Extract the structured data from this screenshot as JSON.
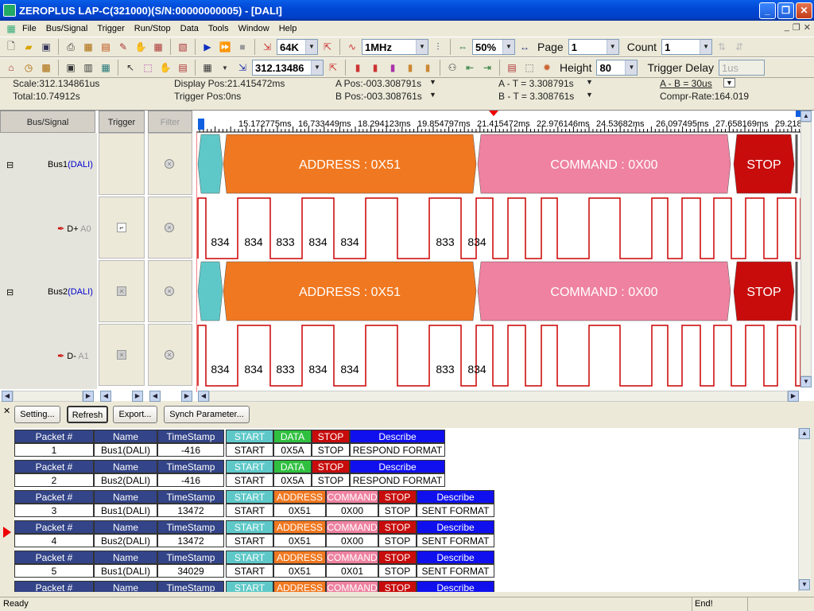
{
  "window": {
    "title": "ZEROPLUS LAP-C(321000)(S/N:00000000005) - [DALI]"
  },
  "menu": [
    "File",
    "Bus/Signal",
    "Trigger",
    "Run/Stop",
    "Data",
    "Tools",
    "Window",
    "Help"
  ],
  "toolbar1": {
    "memory": "64K",
    "rate": "1MHz",
    "zoom": "50%",
    "page_label": "Page",
    "page": "1",
    "count_label": "Count",
    "count": "1"
  },
  "toolbar2": {
    "position": "312.13486",
    "height_label": "Height",
    "height": "80",
    "trigger_delay_label": "Trigger Delay",
    "trigger_delay": "1us"
  },
  "info": {
    "scale": "Scale:312.134861us",
    "total": "Total:10.74912s",
    "display_pos": "Display Pos:21.415472ms",
    "trigger_pos": "Trigger Pos:0ns",
    "a_pos": "A Pos:-003.308791s",
    "b_pos": "B Pos:-003.308761s",
    "a_t": "A - T = 3.308791s",
    "b_t": "B - T = 3.308761s",
    "a_b": "A - B = 30us",
    "compr": "Compr-Rate:164.019"
  },
  "columns": {
    "bus_signal": "Bus/Signal",
    "trigger": "Trigger",
    "filter": "Filter"
  },
  "signals": [
    {
      "name": "Bus1",
      "tag": "(DALI)"
    },
    {
      "name": "D+",
      "tag": "A0"
    },
    {
      "name": "Bus2",
      "tag": "(DALI)"
    },
    {
      "name": "D-",
      "tag": "A1"
    }
  ],
  "time_ticks": [
    "15.172775ms",
    "16.733449ms",
    "18.294123ms",
    "19.854797ms",
    "21.415472ms",
    "22.976146ms",
    "24.53682ms",
    "26.097495ms",
    "27.658169ms",
    "29.218"
  ],
  "bus_segments": [
    {
      "label": "",
      "color": "#5ec8c8"
    },
    {
      "label": "ADDRESS : 0X51",
      "color": "#f07820"
    },
    {
      "label": "COMMAND : 0X00",
      "color": "#ee82a0"
    },
    {
      "label": "STOP",
      "color": "#c80c0c"
    }
  ],
  "pulse_labels": [
    "834",
    "834",
    "833",
    "834",
    "834",
    "833",
    "834"
  ],
  "buttons": {
    "setting": "Setting...",
    "refresh": "Refresh",
    "export": "Export...",
    "synch": "Synch Parameter..."
  },
  "packets": [
    {
      "header": [
        "Packet #",
        "Name",
        "TimeStamp",
        "START",
        "DATA",
        "STOP",
        "Describe"
      ],
      "values": [
        "1",
        "Bus1(DALI)",
        "-416",
        "START",
        "0X5A",
        "STOP",
        "RESPOND FORMAT"
      ]
    },
    {
      "header": [
        "Packet #",
        "Name",
        "TimeStamp",
        "START",
        "DATA",
        "STOP",
        "Describe"
      ],
      "values": [
        "2",
        "Bus2(DALI)",
        "-416",
        "START",
        "0X5A",
        "STOP",
        "RESPOND FORMAT"
      ]
    },
    {
      "header": [
        "Packet #",
        "Name",
        "TimeStamp",
        "START",
        "ADDRESS",
        "COMMAND",
        "STOP",
        "Describe"
      ],
      "values": [
        "3",
        "Bus1(DALI)",
        "13472",
        "START",
        "0X51",
        "0X00",
        "STOP",
        "SENT FORMAT"
      ]
    },
    {
      "header": [
        "Packet #",
        "Name",
        "TimeStamp",
        "START",
        "ADDRESS",
        "COMMAND",
        "STOP",
        "Describe"
      ],
      "values": [
        "4",
        "Bus2(DALI)",
        "13472",
        "START",
        "0X51",
        "0X00",
        "STOP",
        "SENT FORMAT"
      ]
    },
    {
      "header": [
        "Packet #",
        "Name",
        "TimeStamp",
        "START",
        "ADDRESS",
        "COMMAND",
        "STOP",
        "Describe"
      ],
      "values": [
        "5",
        "Bus1(DALI)",
        "34029",
        "START",
        "0X51",
        "0X01",
        "STOP",
        "SENT FORMAT"
      ]
    },
    {
      "header": [
        "Packet #",
        "Name",
        "TimeStamp",
        "START",
        "ADDRESS",
        "COMMAND",
        "STOP",
        "Describe"
      ],
      "values": [
        "",
        "",
        "",
        "",
        "",
        "",
        "",
        ""
      ]
    }
  ],
  "header_colors": {
    "Packet #": "#334488",
    "Name": "#334488",
    "TimeStamp": "#334488",
    "START": "#5ec8c8",
    "DATA": "#30c040",
    "ADDRESS": "#f07820",
    "COMMAND": "#ee82a0",
    "STOP": "#c80c0c",
    "Describe": "#1010ee"
  },
  "status": {
    "left": "Ready",
    "right": "End!"
  }
}
